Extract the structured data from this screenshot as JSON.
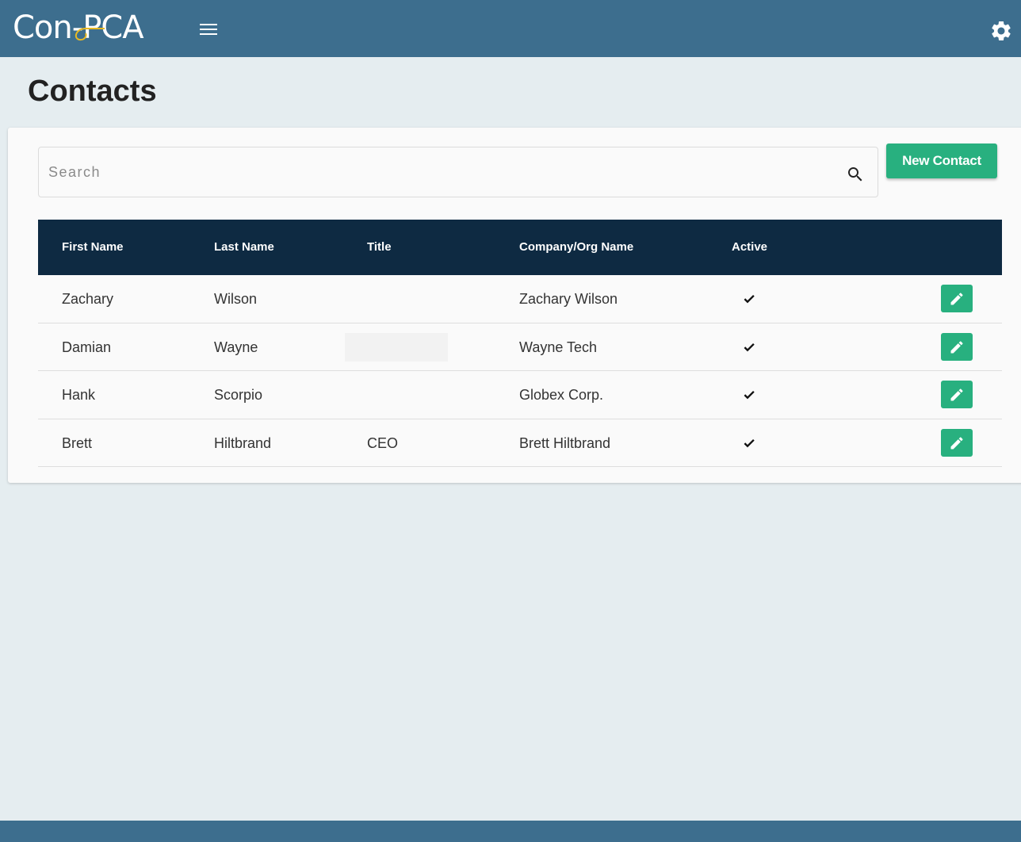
{
  "header": {
    "logo_text": "Con-PCA",
    "menu_icon": "hamburger-menu-icon",
    "settings_icon": "gear-icon"
  },
  "page": {
    "title": "Contacts"
  },
  "search": {
    "placeholder": "Search",
    "value": "",
    "icon": "search-icon"
  },
  "toolbar": {
    "new_contact_label": "New Contact"
  },
  "table": {
    "headers": {
      "first_name": "First Name",
      "last_name": "Last Name",
      "title": "Title",
      "company": "Company/Org Name",
      "active": "Active"
    },
    "rows": [
      {
        "first_name": "Zachary",
        "last_name": "Wilson",
        "title": "",
        "company": "Zachary Wilson",
        "active": true
      },
      {
        "first_name": "Damian",
        "last_name": "Wayne",
        "title": "",
        "company": "Wayne Tech",
        "active": true
      },
      {
        "first_name": "Hank",
        "last_name": "Scorpio",
        "title": "",
        "company": "Globex Corp.",
        "active": true
      },
      {
        "first_name": "Brett",
        "last_name": "Hiltbrand",
        "title": "CEO",
        "company": "Brett Hiltbrand",
        "active": true
      }
    ]
  },
  "colors": {
    "header_bg": "#3d6e8e",
    "table_header_bg": "#0e2a42",
    "accent_green": "#28b07f",
    "page_bg": "#e5edf0",
    "logo_accent": "#e8b923"
  }
}
